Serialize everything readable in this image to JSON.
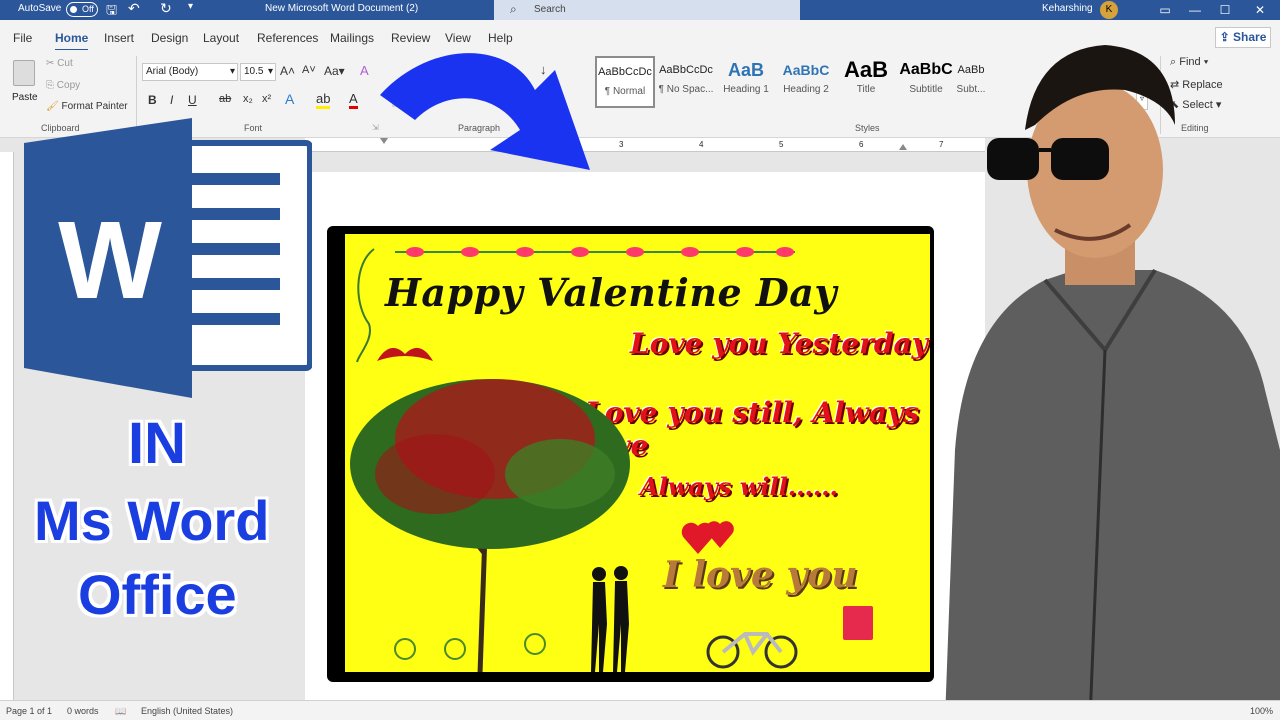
{
  "titlebar": {
    "autosave_label": "AutoSave",
    "autosave_state": "Off",
    "document_title": "New Microsoft Word Document (2)",
    "search_placeholder": "Search",
    "user_name": "Keharshing",
    "user_initial": "K"
  },
  "menu": {
    "tabs": [
      "File",
      "Home",
      "Insert",
      "Design",
      "Layout",
      "References",
      "Mailings",
      "Review",
      "View",
      "Help"
    ],
    "active_tab": "Home",
    "share_label": "Share"
  },
  "ribbon": {
    "clipboard": {
      "paste_label": "Paste",
      "cut_label": "Cut",
      "copy_label": "Copy",
      "format_painter_label": "Format Painter",
      "group_label": "Clipboard"
    },
    "font": {
      "font_name": "Arial (Body)",
      "font_size": "10.5",
      "group_label": "Font"
    },
    "paragraph": {
      "group_label": "Paragraph"
    },
    "styles": {
      "items": [
        {
          "preview": "AaBbCcDc",
          "name": "¶ Normal"
        },
        {
          "preview": "AaBbCcDc",
          "name": "¶ No Spac..."
        },
        {
          "preview": "AaB",
          "name": "Heading 1"
        },
        {
          "preview": "AaBbC",
          "name": "Heading 2"
        },
        {
          "preview": "AaB",
          "name": "Title"
        },
        {
          "preview": "AaBbC",
          "name": "Subtitle"
        },
        {
          "preview": "AaBb",
          "name": "Subt..."
        }
      ],
      "group_label": "Styles"
    },
    "editing": {
      "find_label": "Find",
      "replace_label": "Replace",
      "select_label": "Select",
      "group_label": "Editing"
    }
  },
  "ruler_numbers": [
    "3",
    "4",
    "5",
    "6",
    "7"
  ],
  "card": {
    "title": "Happy Valentine Day",
    "line1": "Love you Yesterday",
    "line2": "Love you still, Always love",
    "line3": "Always will......",
    "i_love_you": "I love you"
  },
  "overlay": {
    "caption_in": "IN",
    "caption_msword": "Ms Word",
    "caption_office": "Office"
  },
  "statusbar": {
    "page": "Page 1 of 1",
    "words": "0 words",
    "language": "English (United States)",
    "zoom": "100%"
  },
  "colors": {
    "word_blue": "#2b579a",
    "caption_blue": "#1a3ee0",
    "card_yellow": "#ffff14",
    "card_red": "#e11019"
  }
}
